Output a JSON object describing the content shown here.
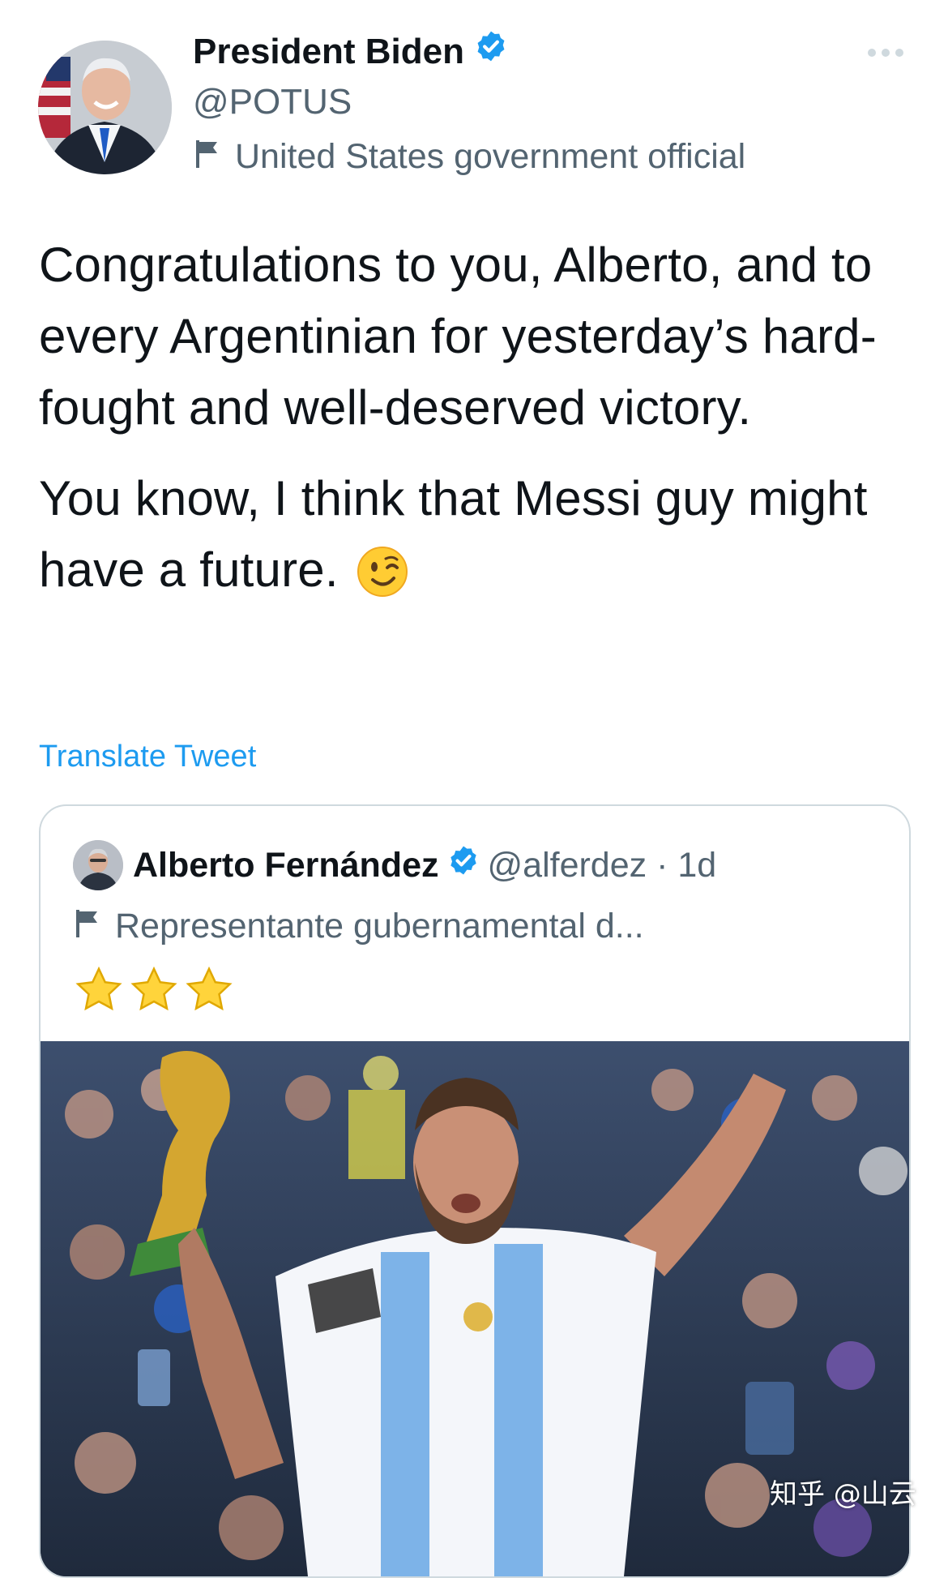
{
  "author": {
    "display_name": "President Biden",
    "handle": "@POTUS",
    "label": "United States government official"
  },
  "tweet": {
    "paragraphs": [
      "Congratulations to you, Alberto, and to every Argentinian for yesterday’s hard-fought and well-deserved victory.",
      "You know, I think that Messi guy might have a future."
    ],
    "emoji": "winking-face",
    "translate_label": "Translate Tweet"
  },
  "quoted_tweet": {
    "display_name": "Alberto Fernández",
    "handle_time": "@alferdez · 1d",
    "label": "Representante gubernamental d...",
    "stars": 3
  },
  "watermark": "知乎 @山云",
  "colors": {
    "accent": "#1d9bf0",
    "text": "#0f1419",
    "secondary": "#536471",
    "border": "#cfd9de"
  }
}
